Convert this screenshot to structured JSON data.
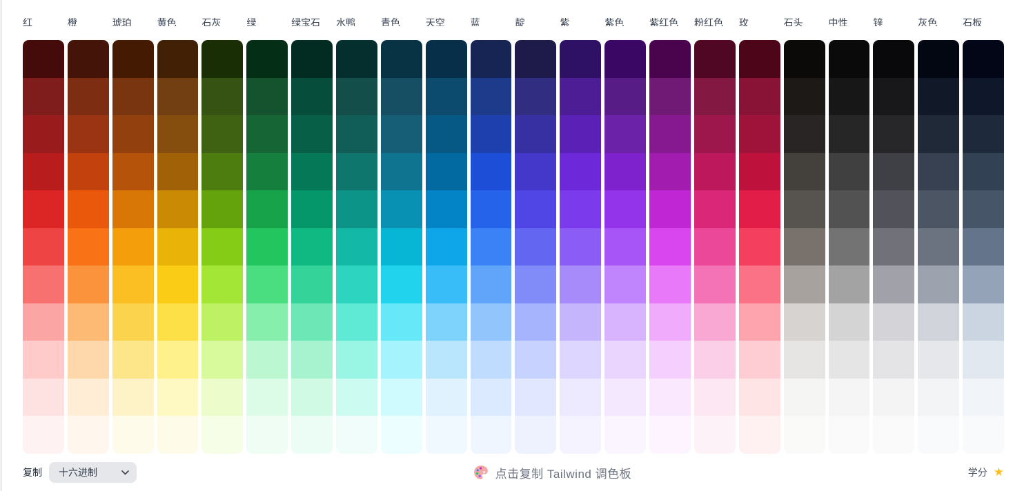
{
  "palette": {
    "shade_steps": [
      950,
      900,
      800,
      700,
      600,
      500,
      400,
      300,
      200,
      100,
      50
    ],
    "columns": [
      {
        "name": "red",
        "label": "红",
        "shades": [
          "#450a0a",
          "#7f1d1d",
          "#991b1b",
          "#b91c1c",
          "#dc2626",
          "#ef4444",
          "#f87171",
          "#fca5a5",
          "#fecaca",
          "#fee2e2",
          "#fef2f2"
        ]
      },
      {
        "name": "orange",
        "label": "橙",
        "shades": [
          "#431407",
          "#7c2d12",
          "#9a3412",
          "#c2410c",
          "#ea580c",
          "#f97316",
          "#fb923c",
          "#fdba74",
          "#fed7aa",
          "#ffedd5",
          "#fff7ed"
        ]
      },
      {
        "name": "amber",
        "label": "琥珀",
        "shades": [
          "#451a03",
          "#78350f",
          "#92400e",
          "#b45309",
          "#d97706",
          "#f59e0b",
          "#fbbf24",
          "#fcd34d",
          "#fde68a",
          "#fef3c7",
          "#fffbeb"
        ]
      },
      {
        "name": "yellow",
        "label": "黄色",
        "shades": [
          "#422006",
          "#713f12",
          "#854d0e",
          "#a16207",
          "#ca8a04",
          "#eab308",
          "#facc15",
          "#fde047",
          "#fef08a",
          "#fef9c3",
          "#fefce8"
        ]
      },
      {
        "name": "lime",
        "label": "石灰",
        "shades": [
          "#1a2e05",
          "#365314",
          "#3f6212",
          "#4d7c0f",
          "#65a30d",
          "#84cc16",
          "#a3e635",
          "#bef264",
          "#d9f99d",
          "#ecfccb",
          "#f7fee7"
        ]
      },
      {
        "name": "green",
        "label": "绿",
        "shades": [
          "#052e16",
          "#14532d",
          "#166534",
          "#15803d",
          "#16a34a",
          "#22c55e",
          "#4ade80",
          "#86efac",
          "#bbf7d0",
          "#dcfce7",
          "#f0fdf4"
        ]
      },
      {
        "name": "emerald",
        "label": "绿宝石",
        "shades": [
          "#022c22",
          "#064e3b",
          "#065f46",
          "#047857",
          "#059669",
          "#10b981",
          "#34d399",
          "#6ee7b7",
          "#a7f3d0",
          "#d1fae5",
          "#ecfdf5"
        ]
      },
      {
        "name": "teal",
        "label": "水鸭",
        "shades": [
          "#042f2e",
          "#134e4a",
          "#115e59",
          "#0f766e",
          "#0d9488",
          "#14b8a6",
          "#2dd4bf",
          "#5eead4",
          "#99f6e4",
          "#ccfbf1",
          "#f0fdfa"
        ]
      },
      {
        "name": "cyan",
        "label": "青色",
        "shades": [
          "#083344",
          "#164e63",
          "#155e75",
          "#0e7490",
          "#0891b2",
          "#06b6d4",
          "#22d3ee",
          "#67e8f9",
          "#a5f3fc",
          "#cffafe",
          "#ecfeff"
        ]
      },
      {
        "name": "sky",
        "label": "天空",
        "shades": [
          "#082f49",
          "#0c4a6e",
          "#075985",
          "#0369a1",
          "#0284c7",
          "#0ea5e9",
          "#38bdf8",
          "#7dd3fc",
          "#bae6fd",
          "#e0f2fe",
          "#f0f9ff"
        ]
      },
      {
        "name": "blue",
        "label": "蓝",
        "shades": [
          "#172554",
          "#1e3a8a",
          "#1e40af",
          "#1d4ed8",
          "#2563eb",
          "#3b82f6",
          "#60a5fa",
          "#93c5fd",
          "#bfdbfe",
          "#dbeafe",
          "#eff6ff"
        ]
      },
      {
        "name": "indigo",
        "label": "靛",
        "shades": [
          "#1e1b4b",
          "#312e81",
          "#3730a3",
          "#4338ca",
          "#4f46e5",
          "#6366f1",
          "#818cf8",
          "#a5b4fc",
          "#c7d2fe",
          "#e0e7ff",
          "#eef2ff"
        ]
      },
      {
        "name": "violet",
        "label": "紫",
        "shades": [
          "#2e1065",
          "#4c1d95",
          "#5b21b6",
          "#6d28d9",
          "#7c3aed",
          "#8b5cf6",
          "#a78bfa",
          "#c4b5fd",
          "#ddd6fe",
          "#ede9fe",
          "#f5f3ff"
        ]
      },
      {
        "name": "purple",
        "label": "紫色",
        "shades": [
          "#3b0764",
          "#581c87",
          "#6b21a8",
          "#7e22ce",
          "#9333ea",
          "#a855f7",
          "#c084fc",
          "#d8b4fe",
          "#e9d5ff",
          "#f3e8ff",
          "#faf5ff"
        ]
      },
      {
        "name": "fuchsia",
        "label": "紫红色",
        "shades": [
          "#4a044e",
          "#701a75",
          "#86198f",
          "#a21caf",
          "#c026d3",
          "#d946ef",
          "#e879f9",
          "#f0abfc",
          "#f5d0fe",
          "#fae8ff",
          "#fdf4ff"
        ]
      },
      {
        "name": "pink",
        "label": "粉红色",
        "shades": [
          "#500724",
          "#831843",
          "#9d174d",
          "#be185d",
          "#db2777",
          "#ec4899",
          "#f472b6",
          "#f9a8d4",
          "#fbcfe8",
          "#fce7f3",
          "#fdf2f8"
        ]
      },
      {
        "name": "rose",
        "label": "玫",
        "shades": [
          "#4c0519",
          "#881337",
          "#9f1239",
          "#be123c",
          "#e11d48",
          "#f43f5e",
          "#fb7185",
          "#fda4af",
          "#fecdd3",
          "#ffe4e6",
          "#fff1f2"
        ]
      },
      {
        "name": "stone",
        "label": "石头",
        "shades": [
          "#0c0a09",
          "#1c1917",
          "#292524",
          "#44403c",
          "#57534e",
          "#78716c",
          "#a8a29e",
          "#d6d3d1",
          "#e7e5e4",
          "#f5f5f4",
          "#fafaf9"
        ]
      },
      {
        "name": "neutral",
        "label": "中性",
        "shades": [
          "#0a0a0a",
          "#171717",
          "#262626",
          "#404040",
          "#525252",
          "#737373",
          "#a3a3a3",
          "#d4d4d4",
          "#e5e5e5",
          "#f5f5f5",
          "#fafafa"
        ]
      },
      {
        "name": "zinc",
        "label": "锌",
        "shades": [
          "#09090b",
          "#18181b",
          "#27272a",
          "#3f3f46",
          "#52525b",
          "#71717a",
          "#a1a1aa",
          "#d4d4d8",
          "#e4e4e7",
          "#f4f4f5",
          "#fafafa"
        ]
      },
      {
        "name": "gray",
        "label": "灰色",
        "shades": [
          "#030712",
          "#111827",
          "#1f2937",
          "#374151",
          "#4b5563",
          "#6b7280",
          "#9ca3af",
          "#d1d5db",
          "#e5e7eb",
          "#f3f4f6",
          "#f9fafb"
        ]
      },
      {
        "name": "slate",
        "label": "石板",
        "shades": [
          "#020617",
          "#0f172a",
          "#1e293b",
          "#334155",
          "#475569",
          "#64748b",
          "#94a3b8",
          "#cbd5e1",
          "#e2e8f0",
          "#f1f5f9",
          "#f8fafc"
        ]
      }
    ]
  },
  "footer": {
    "copy_label": "复制",
    "format_selected": "十六进制",
    "hint_icon": "palette-icon",
    "hint_text": "点击复制 Tailwind 调色板",
    "credits_label": "学分",
    "credits_icon": "star-icon",
    "star_glyph": "★",
    "star_color": "#fbbf24"
  }
}
